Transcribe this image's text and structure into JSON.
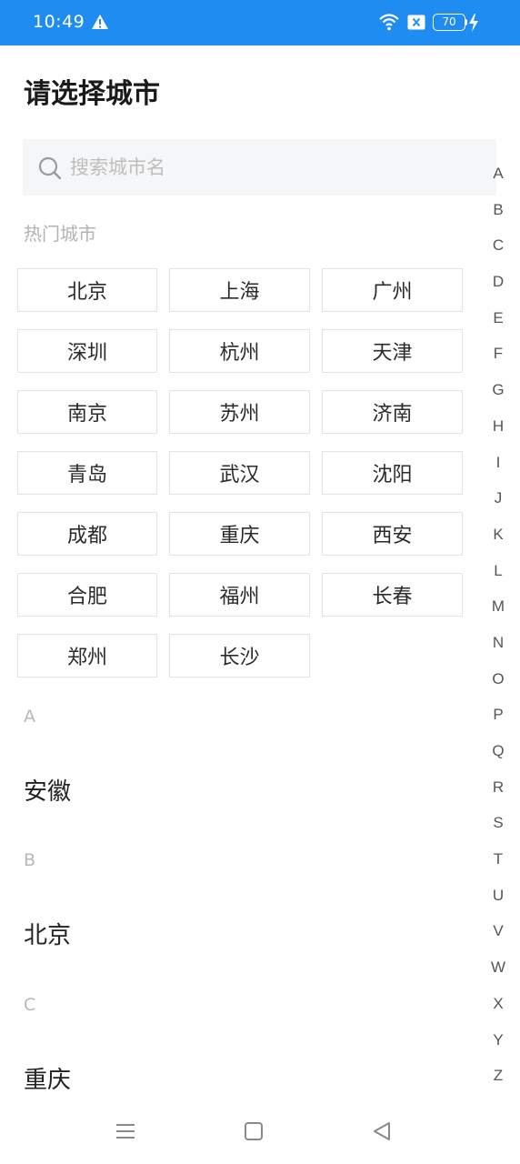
{
  "status_bar": {
    "time": "10:49",
    "battery": "70",
    "icons": [
      "warning-icon",
      "wifi-icon",
      "sim-icon",
      "battery-icon",
      "charging-icon"
    ]
  },
  "page": {
    "title": "请选择城市"
  },
  "search": {
    "placeholder": "搜索城市名",
    "value": ""
  },
  "hot": {
    "label": "热门城市",
    "cities": [
      "北京",
      "上海",
      "广州",
      "深圳",
      "杭州",
      "天津",
      "南京",
      "苏州",
      "济南",
      "青岛",
      "武汉",
      "沈阳",
      "成都",
      "重庆",
      "西安",
      "合肥",
      "福州",
      "长春",
      "郑州",
      "长沙"
    ]
  },
  "groups": [
    {
      "letter": "A",
      "city": "安徽"
    },
    {
      "letter": "B",
      "city": "北京"
    },
    {
      "letter": "C",
      "city": "重庆"
    }
  ],
  "index_letters": [
    "A",
    "B",
    "C",
    "D",
    "E",
    "F",
    "G",
    "H",
    "I",
    "J",
    "K",
    "L",
    "M",
    "N",
    "O",
    "P",
    "Q",
    "R",
    "S",
    "T",
    "U",
    "V",
    "W",
    "X",
    "Y",
    "Z"
  ],
  "colors": {
    "status_bar": "#1e8cf0",
    "search_bg": "#f5f6f8",
    "muted_text": "#b3b3b3"
  }
}
